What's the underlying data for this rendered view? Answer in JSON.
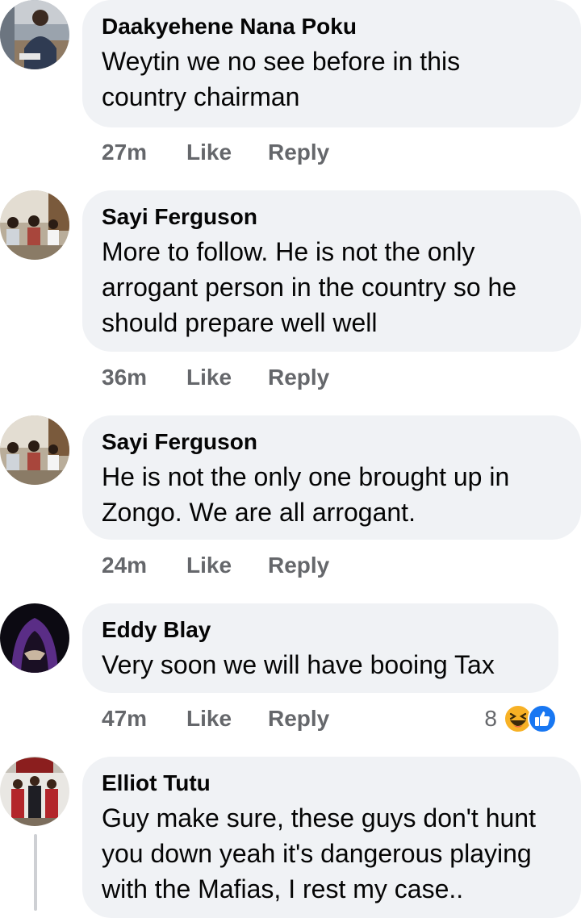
{
  "comments": [
    {
      "author": "Daakyehene Nana Poku",
      "lines": [
        "Weytin we no see before in this",
        "country chairman"
      ],
      "time": "27m",
      "like": "Like",
      "reply": "Reply",
      "avatar_icon": "profile-photo"
    },
    {
      "author": "Sayi Ferguson",
      "lines": [
        "More to follow. He is not the only",
        "arrogant person in the country so he",
        "should prepare well well"
      ],
      "time": "36m",
      "like": "Like",
      "reply": "Reply",
      "avatar_icon": "profile-photo"
    },
    {
      "author": "Sayi Ferguson",
      "lines": [
        "He is not the only one brought up in",
        "Zongo. We are all arrogant."
      ],
      "time": "24m",
      "like": "Like",
      "reply": "Reply",
      "avatar_icon": "profile-photo"
    },
    {
      "author": "Eddy Blay",
      "lines": [
        "Very soon we will have booing Tax"
      ],
      "time": "47m",
      "like": "Like",
      "reply": "Reply",
      "reaction_count": "8",
      "reaction_icons": [
        "haha-icon",
        "like-icon"
      ],
      "avatar_icon": "profile-photo"
    },
    {
      "author": "Elliot Tutu",
      "lines": [
        "Guy make sure, these guys don't hunt",
        "you down yeah it's dangerous playing",
        "with the Mafias, I rest my case.."
      ],
      "avatar_icon": "profile-photo"
    }
  ],
  "colors": {
    "bubble": "#f0f2f5",
    "secondary_text": "#65676b",
    "like_blue": "#1877f2",
    "haha_yellow": "#f7b125"
  }
}
